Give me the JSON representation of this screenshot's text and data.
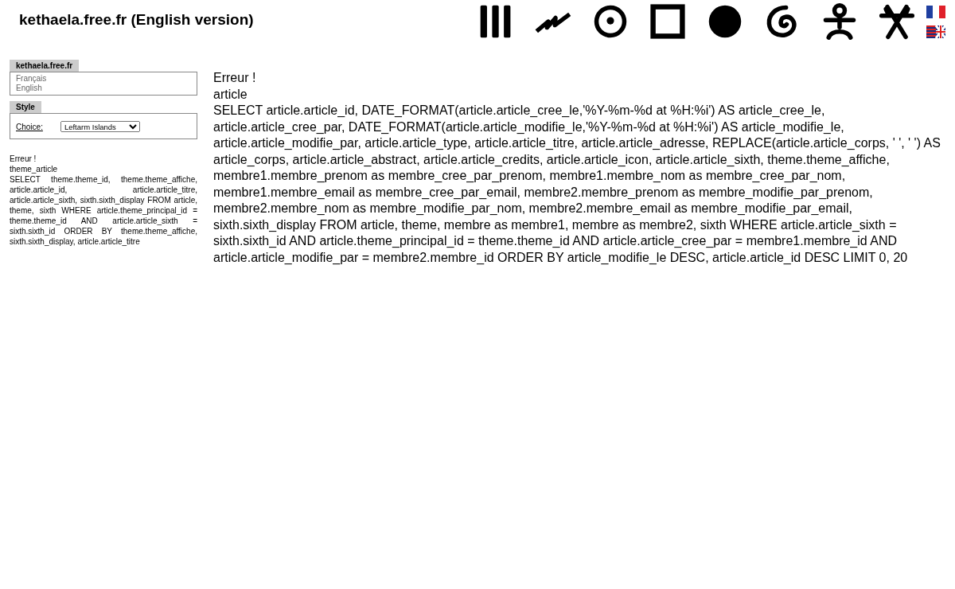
{
  "header": {
    "title": "kethaela.free.fr (English version)"
  },
  "sidebar": {
    "site_box": {
      "title": "kethaela.free.fr",
      "links": [
        "Français",
        "English"
      ]
    },
    "style_box": {
      "title": "Style",
      "label": "Choice:",
      "select_value": "Leftarm Islands"
    },
    "error": {
      "lines": [
        "Erreur !",
        "theme_article"
      ],
      "query": "SELECT theme.theme_id, theme.theme_affiche, article.article_id, article.article_titre, article.article_sixth, sixth.sixth_display FROM article, theme, sixth WHERE article.theme_principal_id = theme.theme_id AND article.article_sixth = sixth.sixth_id ORDER BY theme.theme_affiche, sixth.sixth_display, article.article_titre"
    }
  },
  "main": {
    "lines": [
      "Erreur !",
      "article"
    ],
    "query": "SELECT article.article_id, DATE_FORMAT(article.article_cree_le,'%Y-%m-%d at %H:%i') AS article_cree_le, article.article_cree_par, DATE_FORMAT(article.article_modifie_le,'%Y-%m-%d at %H:%i') AS article_modifie_le, article.article_modifie_par, article.article_type, article.article_titre, article.article_adresse, REPLACE(article.article_corps, ' ', ' ') AS article_corps, article.article_abstract, article.article_credits, article.article_icon, article.article_sixth, theme.theme_affiche, membre1.membre_prenom as membre_cree_par_prenom, membre1.membre_nom as membre_cree_par_nom, membre1.membre_email as membre_cree_par_email, membre2.membre_prenom as membre_modifie_par_prenom, membre2.membre_nom as membre_modifie_par_nom, membre2.membre_email as membre_modifie_par_email, sixth.sixth_display FROM article, theme, membre as membre1, membre as membre2, sixth WHERE article.article_sixth = sixth.sixth_id AND article.theme_principal_id = theme.theme_id AND article.article_cree_par = membre1.membre_id AND article.article_modifie_par = membre2.membre_id ORDER BY article_modifie_le DESC, article.article_id DESC LIMIT 0, 20"
  }
}
